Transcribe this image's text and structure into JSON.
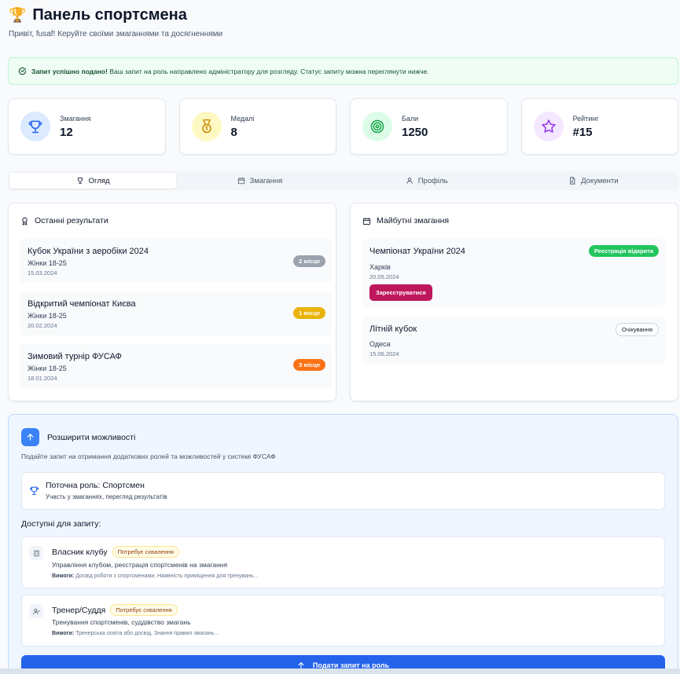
{
  "header": {
    "title": "Панель спортсмена",
    "subtitle": "Привіт, fusaf! Керуйте своїми змаганнями та досягненнями"
  },
  "alert": {
    "strong": "Запит успішно подано!",
    "text": "Ваш запит на роль направлено адміністратору для розгляду. Статус запиту можна переглянути нижче."
  },
  "stats": [
    {
      "label": "Змагання",
      "value": "12",
      "icon": "trophy-icon",
      "color": "#2563eb",
      "bg": "#dbeafe"
    },
    {
      "label": "Медалі",
      "value": "8",
      "icon": "medal-icon",
      "color": "#ca8a04",
      "bg": "#fef9c3"
    },
    {
      "label": "Бали",
      "value": "1250",
      "icon": "target-icon",
      "color": "#16a34a",
      "bg": "#dcfce7"
    },
    {
      "label": "Рейтинг",
      "value": "#15",
      "icon": "star-icon",
      "color": "#9333ea",
      "bg": "#f3e8ff"
    }
  ],
  "tabs": [
    {
      "label": "Огляд",
      "icon": "trophy-icon",
      "active": true
    },
    {
      "label": "Змагання",
      "icon": "calendar-icon",
      "active": false
    },
    {
      "label": "Профіль",
      "icon": "user-icon",
      "active": false
    },
    {
      "label": "Документи",
      "icon": "document-icon",
      "active": false
    }
  ],
  "results": {
    "title": "Останні результати",
    "items": [
      {
        "name": "Кубок України з аеробіки 2024",
        "category": "Жінки 18-25",
        "date": "15.03.2024",
        "place": "2 місце",
        "color": "#9ca3af"
      },
      {
        "name": "Відкритий чемпіонат Києва",
        "category": "Жінки 18-25",
        "date": "20.02.2024",
        "place": "1 місце",
        "color": "#eab308"
      },
      {
        "name": "Зимовий турнір ФУСАФ",
        "category": "Жінки 18-25",
        "date": "18.01.2024",
        "place": "3 місце",
        "color": "#f97316"
      }
    ]
  },
  "upcoming": {
    "title": "Майбутні змагання",
    "items": [
      {
        "name": "Чемпіонат України 2024",
        "city": "Харків",
        "date": "20.05.2024",
        "status": "Реєстрація відкрита",
        "button": "Зареєструватися"
      },
      {
        "name": "Літній кубок",
        "city": "Одеса",
        "date": "15.06.2024",
        "status": "Очікування"
      }
    ]
  },
  "expand": {
    "title": "Розширити можливості",
    "subtitle": "Подайте запит на отримання додаткових ролей та можливостей у системі ФУСАФ",
    "current_role": "Поточна роль: Спортсмен",
    "current_desc": "Участь у змаганнях, перегляд результатів",
    "available_title": "Доступні для запиту:",
    "requirements_label": "Вимоги:",
    "roles": [
      {
        "name": "Власник клубу",
        "badge": "Потребує схвалення",
        "desc": "Управління клубом, реєстрація спортсменів на змагання",
        "req": "Досвід роботи з спортсменами, Наявність приміщення для тренувань..."
      },
      {
        "name": "Тренер/Суддя",
        "badge": "Потребує схвалення",
        "desc": "Тренування спортсменів, суддівство змагань",
        "req": "Тренерська освіта або досвід, Знання правил змагань..."
      }
    ],
    "submit": "Подати запит на роль"
  }
}
